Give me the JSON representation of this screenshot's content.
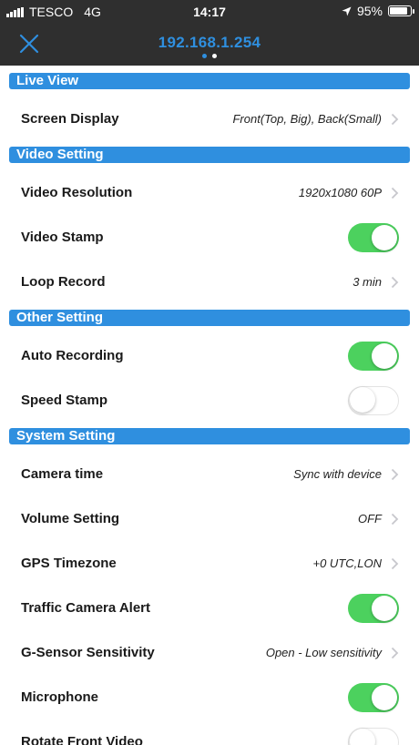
{
  "status_bar": {
    "carrier": "TESCO",
    "network": "4G",
    "time": "14:17",
    "battery": "95%",
    "battery_level": 0.95
  },
  "nav": {
    "title": "192.168.1.254"
  },
  "sections": {
    "live_view": {
      "title": "Live View",
      "screen_display": {
        "label": "Screen Display",
        "value": "Front(Top, Big), Back(Small)"
      }
    },
    "video_setting": {
      "title": "Video Setting",
      "video_resolution": {
        "label": "Video Resolution",
        "value": "1920x1080 60P"
      },
      "video_stamp": {
        "label": "Video Stamp",
        "on": true
      },
      "loop_record": {
        "label": "Loop Record",
        "value": "3 min"
      }
    },
    "other_setting": {
      "title": "Other Setting",
      "auto_recording": {
        "label": "Auto Recording",
        "on": true
      },
      "speed_stamp": {
        "label": "Speed Stamp",
        "on": false
      }
    },
    "system_setting": {
      "title": "System Setting",
      "camera_time": {
        "label": "Camera time",
        "value": "Sync with device"
      },
      "volume_setting": {
        "label": "Volume Setting",
        "value": "OFF"
      },
      "gps_timezone": {
        "label": "GPS Timezone",
        "value": "+0 UTC,LON"
      },
      "traffic_camera_alert": {
        "label": "Traffic Camera Alert",
        "on": true
      },
      "g_sensor": {
        "label": "G-Sensor Sensitivity",
        "value": "Open - Low sensitivity"
      },
      "microphone": {
        "label": "Microphone",
        "on": true
      },
      "rotate_front_video": {
        "label": "Rotate Front Video",
        "on": false
      }
    }
  },
  "colors": {
    "accent": "#2f8fdf",
    "toggle_on": "#4cd15e",
    "bar_bg": "#2f2f2f"
  }
}
